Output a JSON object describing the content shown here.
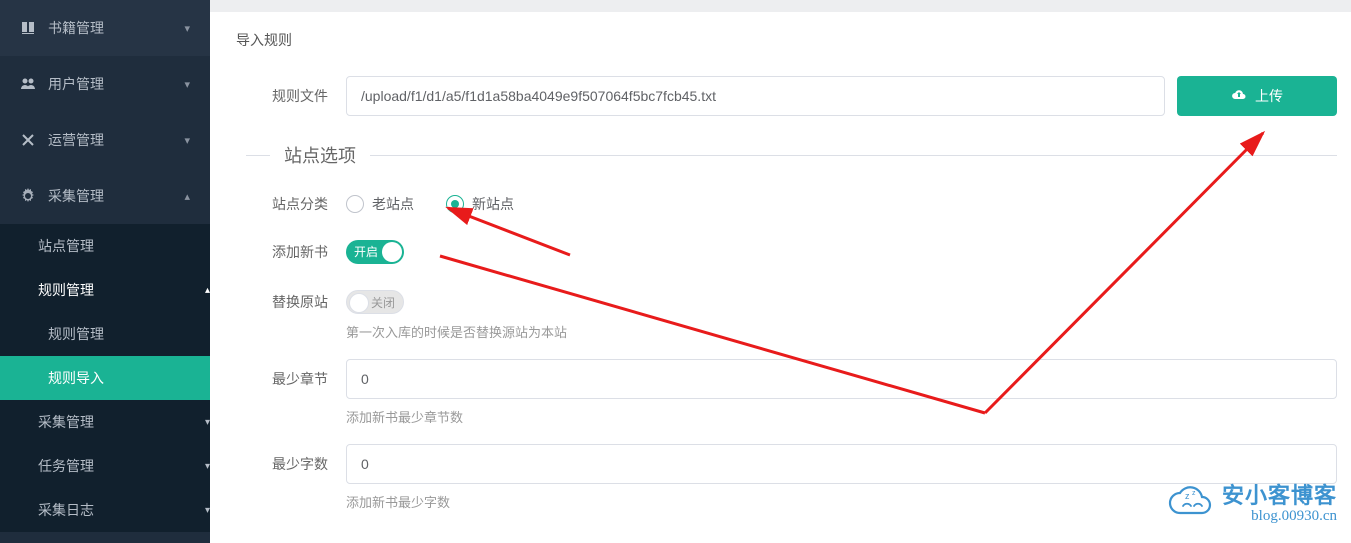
{
  "sidebar": {
    "items": [
      {
        "icon": "book-icon",
        "label": "书籍管理",
        "arrow": "▾"
      },
      {
        "icon": "users-icon",
        "label": "用户管理",
        "arrow": "▾"
      },
      {
        "icon": "tools-icon",
        "label": "运营管理",
        "arrow": "▾"
      },
      {
        "icon": "gear-icon",
        "label": "采集管理",
        "arrow": "▴"
      }
    ],
    "sub": {
      "site_manage": "站点管理",
      "rule_manage": "规则管理",
      "rule_manage_child": "规则管理",
      "rule_import": "规则导入",
      "collect_manage": "采集管理",
      "task_manage": "任务管理",
      "collect_log": "采集日志"
    }
  },
  "breadcrumb": "导入规则",
  "form": {
    "rule_file_label": "规则文件",
    "rule_file_value": "/upload/f1/d1/a5/f1d1a58ba4049e9f507064f5bc7fcb45.txt",
    "upload_btn": "上传",
    "section_title": "站点选项",
    "site_category_label": "站点分类",
    "radio_old": "老站点",
    "radio_new": "新站点",
    "add_book_label": "添加新书",
    "switch_on_text": "开启",
    "replace_label": "替换原站",
    "switch_off_text": "关闭",
    "replace_helper": "第一次入库的时候是否替换源站为本站",
    "min_chapter_label": "最少章节",
    "min_chapter_value": "0",
    "min_chapter_helper": "添加新书最少章节数",
    "min_words_label": "最少字数",
    "min_words_value": "0",
    "min_words_helper": "添加新书最少字数"
  },
  "watermark": {
    "title": "安小客博客",
    "sub": "blog.00930.cn"
  }
}
